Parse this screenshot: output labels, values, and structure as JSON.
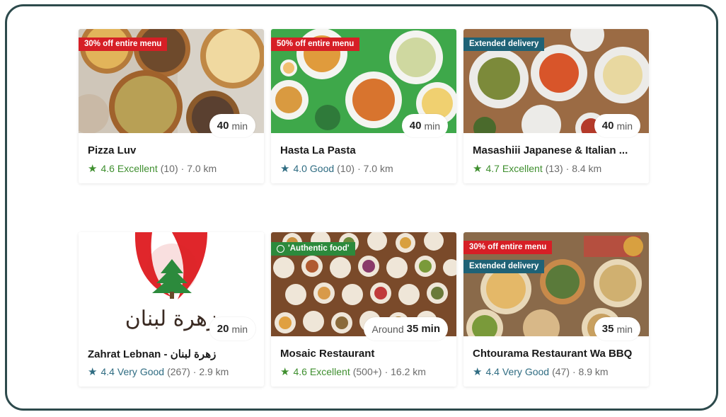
{
  "colors": {
    "excellent": "#3f8f2f",
    "good": "#2f6c82",
    "offer_badge": "#d61f26",
    "delivery_badge": "#1f6276",
    "tag_badge": "#2c8a3c"
  },
  "cards": [
    {
      "name": "Pizza Luv",
      "badges": [
        "30% off entire menu"
      ],
      "time_value": "40",
      "time_unit": "min",
      "rating": "4.6",
      "rating_label": "Excellent",
      "reviews": "(10)",
      "distance": "· 7.0 km"
    },
    {
      "name": "Hasta La Pasta",
      "badges": [
        "50% off entire menu"
      ],
      "time_value": "40",
      "time_unit": "min",
      "rating": "4.0",
      "rating_label": "Good",
      "reviews": "(10)",
      "distance": "· 7.0 km"
    },
    {
      "name": "Masashiii Japanese & Italian ...",
      "badges": [
        "Extended delivery"
      ],
      "time_value": "40",
      "time_unit": "min",
      "rating": "4.7",
      "rating_label": "Excellent",
      "reviews": "(13)",
      "distance": "· 8.4 km"
    },
    {
      "name": "Zahrat Lebnan - زهرة لبنان",
      "logo_text": "زهرة لبنان",
      "time_value": "20",
      "time_unit": "min",
      "rating": "4.4",
      "rating_label": "Very Good",
      "reviews": "(267)",
      "distance": "· 2.9 km"
    },
    {
      "name": "Mosaic Restaurant",
      "badges": [
        "'Authentic food'"
      ],
      "time_prefix": "Around",
      "time_value": "35",
      "time_unit": "min",
      "rating": "4.6",
      "rating_label": "Excellent",
      "reviews": "(500+)",
      "distance": "· 16.2 km"
    },
    {
      "name": "Chtourama Restaurant Wa BBQ",
      "badges": [
        "30% off entire menu",
        "Extended delivery"
      ],
      "time_value": "35",
      "time_unit": "min",
      "rating": "4.4",
      "rating_label": "Very Good",
      "reviews": "(47)",
      "distance": "· 8.9 km"
    }
  ]
}
